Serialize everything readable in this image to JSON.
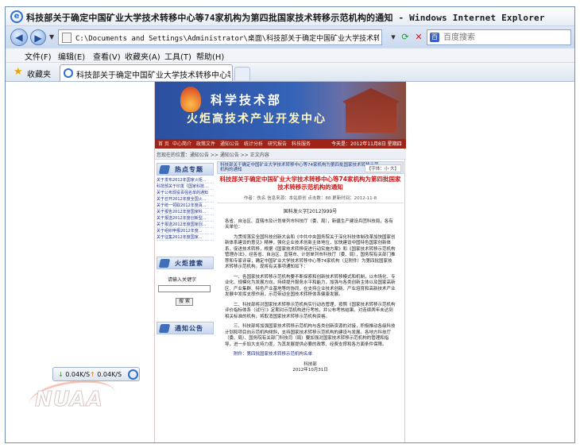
{
  "window": {
    "title": "科技部关于确定中国矿业大学技术转移中心等74家机构为第四批国家技术转移示范机构的通知 - Windows Internet Explorer"
  },
  "address": {
    "url": "C:\\Documents and Settings\\Administrator\\桌面\\科技部关于确定中国矿业大学技术转移中心等74家",
    "search_placeholder": "百度搜索"
  },
  "menu": {
    "items": [
      "文件(F)",
      "编辑(E)",
      "查看(V)",
      "收藏夹(A)",
      "工具(T)",
      "帮助(H)"
    ]
  },
  "favorites": {
    "label": "收藏夹",
    "tab_title": "科技部关于确定中国矿业大学技术转移中心等7..."
  },
  "site": {
    "banner_line1": "科学技术部",
    "banner_line2": "火炬高技术产业开发中心",
    "nav": [
      "首 页",
      "中心简介",
      "政策文件",
      "通知公告",
      "统计分析",
      "研究报告",
      "科技服务"
    ],
    "nav_date": "今天是：2012年11月8日 星期四",
    "breadcrumb": "您现在的位置：通知公告 >> 通知公告 >> 正文内容"
  },
  "sidebar": {
    "hot_header": "热点专题",
    "hot_items": [
      "关于发布2012年国家火炬...",
      "科技部关于印发《国家科技...",
      "关于公布现役百强名单的通知",
      "关于召开2012年度全国火...",
      "关于统一领取2012年度百...",
      "关于报告2012年度国家科...",
      "关于报送2012年度创新型...",
      "关于报送2012年度国家创...",
      "关于组织申报2012年度...",
      "关于征集2012年度国家..."
    ],
    "search_header": "火炬搜索",
    "search_prompt": "请输入关键字",
    "search_button": "搜 索",
    "notice_header": "通知公告"
  },
  "article": {
    "header": "科技部关于确定中国矿业大学技术转移中心等74家机构为第四批国家技术转移示范机构的通知",
    "font_size_label": "【字体：小 大】",
    "title": "科技部关于确定中国矿业大学技术转移中心等74家机构为第四批国家技术转移示范机构的通知",
    "meta": "作者：佚名    信息来源：本站原创    点击数：88    更新时间：2012-11-8",
    "doc_number": "国科发火字[2012]999号",
    "salutation": "各省、自治区、直辖市及计划单列市科技厅（委、局），新疆生产建设兵团科技局，各有关单位：",
    "paragraphs": [
      "为贯彻落实全国科技创新大会和《中共中央国务院关于深化科技体制改革加快国家创新体系建设的意见》精神，强化企业技术创新主体地位，加快建设中国特色国家创新体系，促进技术转移，根据《国家技术转移促进行动实施方案》和《国家技术转移示范机构管理办法》，经各省、自治区、直辖市、计划单列市科技厅（委、局），国务院有关部门推荐和专家评审，确定中国矿业大学技术转移中心等74家机构（见附件）为第四批国家技术转移示范机构。现将有关事项通知如下：",
      "一、各国家技术转移示范机构要不断探索和创新技术转移模式和机制，以市场化、专业化、规模化为发展方向，持续提升服务水平和能力，加强与各类创新主体以及国家高新区、产业集群、特色产业基地等的协同，在支持企业技术创新、产业培育和高新技术产业发展中发挥支撑作用，示范带动全国技术转移体系健康发展。",
      "二、科技部将对国家技术转移示范机构实行动态管理，按照《国家技术转移示范机构评价指标体系（试行）》定期对示范机构进行考核，并公布考核结果。对连续两年未达到相关标准的机构，将取消国家技术转移示范机构资格。",
      "三、科技部将加强国家技术转移示范机构与各类创新资源的对接，积极推动各级科技计划和项目向示范机构倾斜，支持国家技术转移示范机构的建设与发展。各地方科技厅（委、局）、国务院有关部门科技司（局）要加强对国家技术转移示范机构的管理和指导，进一步加大支持力度，为其发展提供必要的政策、经费支撑和各方面条件保障。"
    ],
    "attachment": "附件：第四批国家技术转移示范机构名单",
    "sign_org": "科技部",
    "sign_date": "2012年10月31日"
  },
  "status": {
    "down_speed": "0.04K/S",
    "up_speed": "0.04K/S"
  },
  "watermark": "NUAA"
}
